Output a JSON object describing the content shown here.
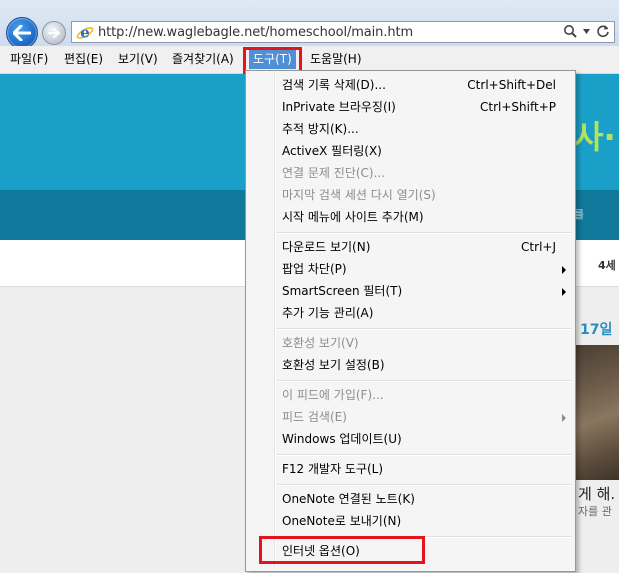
{
  "address_bar": {
    "url": "http://new.waglebagle.net/homeschool/main.htm"
  },
  "menubar": {
    "items": [
      {
        "label": "파일(F)"
      },
      {
        "label": "편집(E)"
      },
      {
        "label": "보기(V)"
      },
      {
        "label": "즐겨찾기(A)"
      },
      {
        "label": "도구(T)"
      },
      {
        "label": "도움말(H)"
      }
    ]
  },
  "background_page": {
    "fragment_nav": "4세",
    "fragment_date": "17일",
    "fragment_headline": "게 해.",
    "fragment_sub": "자를 관",
    "fragment_banner": "사∙",
    "fragment_strip": "를"
  },
  "tools_menu": {
    "items": [
      {
        "label": "검색 기록 삭제(D)...",
        "shortcut": "Ctrl+Shift+Del",
        "enabled": true
      },
      {
        "label": "InPrivate 브라우징(I)",
        "shortcut": "Ctrl+Shift+P",
        "enabled": true
      },
      {
        "label": "추적 방지(K)...",
        "enabled": true
      },
      {
        "label": "ActiveX 필터링(X)",
        "enabled": true
      },
      {
        "label": "연결 문제 진단(C)...",
        "enabled": false
      },
      {
        "label": "마지막 검색 세션 다시 열기(S)",
        "enabled": false
      },
      {
        "label": "시작 메뉴에 사이트 추가(M)",
        "enabled": true
      },
      {
        "label": "다운로드 보기(N)",
        "shortcut": "Ctrl+J",
        "enabled": true
      },
      {
        "label": "팝업 차단(P)",
        "submenu": true,
        "enabled": true
      },
      {
        "label": "SmartScreen 필터(T)",
        "submenu": true,
        "enabled": true
      },
      {
        "label": "추가 기능 관리(A)",
        "enabled": true
      },
      {
        "label": "호환성 보기(V)",
        "enabled": false
      },
      {
        "label": "호환성 보기 설정(B)",
        "enabled": true
      },
      {
        "label": "이 피드에 가입(F)...",
        "enabled": false
      },
      {
        "label": "피드 검색(E)",
        "submenu": true,
        "enabled": false
      },
      {
        "label": "Windows 업데이트(U)",
        "enabled": true
      },
      {
        "label": "F12 개발자 도구(L)",
        "enabled": true
      },
      {
        "label": "OneNote 연결된 노트(K)",
        "enabled": true
      },
      {
        "label": "OneNote로 보내기(N)",
        "enabled": true
      },
      {
        "label": "인터넷 옵션(O)",
        "enabled": true
      }
    ]
  },
  "colors": {
    "highlight": "#e3141c",
    "menu_active": "#4e8fd6",
    "page_banner": "#1aa0c8"
  }
}
